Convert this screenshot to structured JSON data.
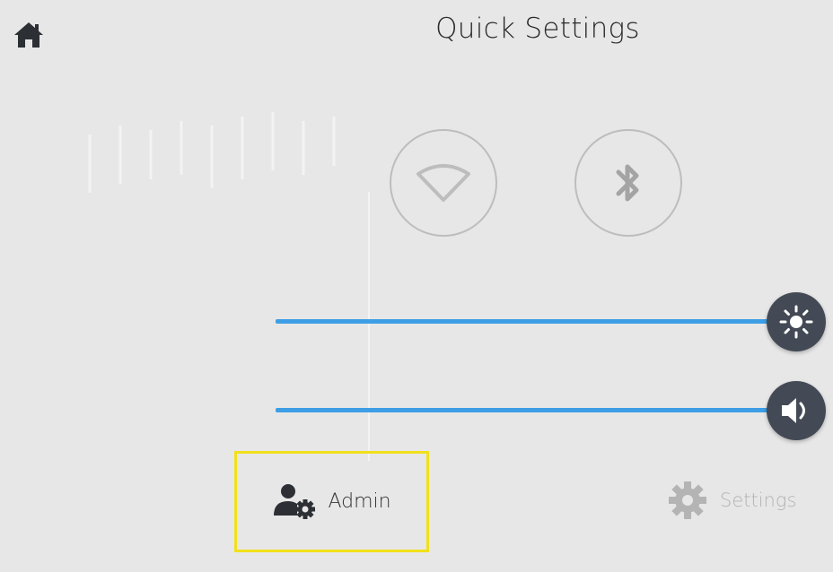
{
  "header": {
    "title": "Quick Settings",
    "home_icon": "home-icon"
  },
  "toggles": {
    "wifi": {
      "icon": "wifi-icon",
      "state": "off"
    },
    "bluetooth": {
      "icon": "bluetooth-icon",
      "state": "off"
    }
  },
  "sliders": {
    "brightness": {
      "icon": "brightness-icon",
      "level": 1.0
    },
    "volume": {
      "icon": "volume-icon",
      "level": 1.0
    }
  },
  "footer": {
    "admin_label": "Admin",
    "admin_icon": "user-gear-icon",
    "settings_label": "Settings",
    "settings_icon": "gear-icon"
  },
  "colors": {
    "background": "#e7e7e7",
    "slider_track": "#3d9ee6",
    "slider_knob": "#434a55",
    "highlight_border": "#f1e01b",
    "toggle_border": "#bdbdbd",
    "disabled_text": "#b4b4b4"
  }
}
